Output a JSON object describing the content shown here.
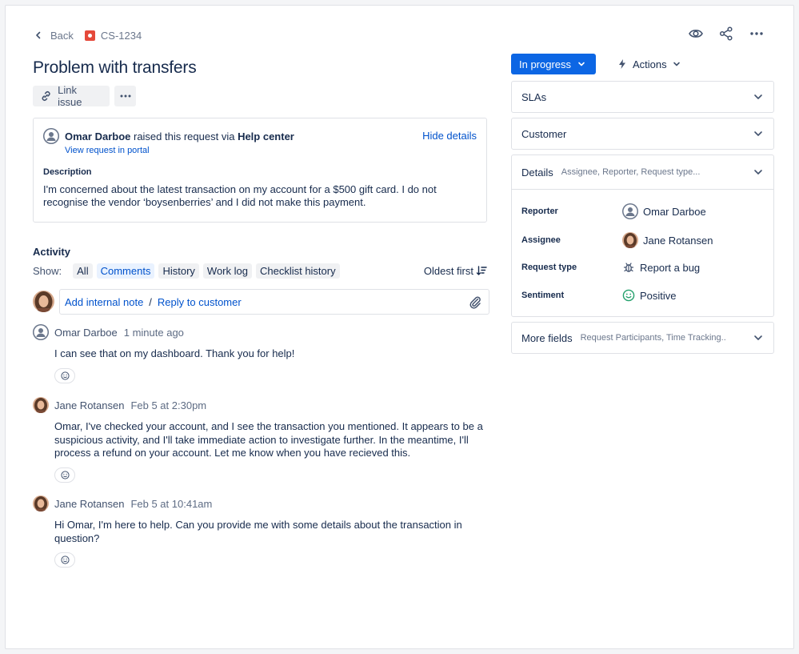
{
  "header": {
    "back_label": "Back",
    "issue_key": "CS-1234",
    "title": "Problem with transfers",
    "icons": [
      "watch-icon",
      "share-icon",
      "more-icon"
    ]
  },
  "toolbar": {
    "link_issue_label": "Link issue"
  },
  "request": {
    "reporter_name": "Omar Darboe",
    "raised_text": " raised this request via ",
    "channel": "Help center",
    "view_portal_label": "View request in portal",
    "hide_details_label": "Hide details",
    "description_label": "Description",
    "description_text": "I'm concerned about the latest transaction on my account for a $500 gift card. I do not recognise the vendor ‘boysenberries’ and I did not make this payment."
  },
  "activity": {
    "label": "Activity",
    "show_label": "Show:",
    "filters": [
      "All",
      "Comments",
      "History",
      "Work log",
      "Checklist history"
    ],
    "active_filter": "Comments",
    "sort_label": "Oldest first",
    "add_internal_note": "Add internal note",
    "separator": "/",
    "reply_to_customer": "Reply to customer",
    "comments": [
      {
        "author": "Omar Darboe",
        "time": "1 minute ago",
        "body": "I can see that on my dashboard. Thank you for help!"
      },
      {
        "author": "Jane Rotansen",
        "time": "Feb 5 at 2:30pm",
        "body": "Omar, I've checked your account, and I see the transaction you mentioned. It appears to be a suspicious activity, and I'll take immediate action to investigate further. In the meantime, I'll process a refund on your account. Let me know when you have recieved this."
      },
      {
        "author": "Jane Rotansen",
        "time": "Feb 5 at 10:41am",
        "body": "Hi Omar, I'm here to help. Can you provide me with some details about the transaction in question?"
      }
    ]
  },
  "sidebar": {
    "status_label": "In progress",
    "actions_label": "Actions",
    "panels": {
      "slas": "SLAs",
      "customer": "Customer",
      "details": "Details",
      "details_sub": "Assignee, Reporter, Request type...",
      "more_fields": "More fields",
      "more_fields_sub": "Request Participants, Time Tracking.."
    },
    "details": {
      "reporter_label": "Reporter",
      "reporter_value": "Omar Darboe",
      "assignee_label": "Assignee",
      "assignee_value": "Jane Rotansen",
      "request_type_label": "Request type",
      "request_type_value": "Report a bug",
      "sentiment_label": "Sentiment",
      "sentiment_value": "Positive"
    }
  },
  "colors": {
    "primary": "#0c66e4",
    "link": "#0052cc",
    "issue_type": "#e5493a",
    "sentiment": "#22a06b"
  }
}
